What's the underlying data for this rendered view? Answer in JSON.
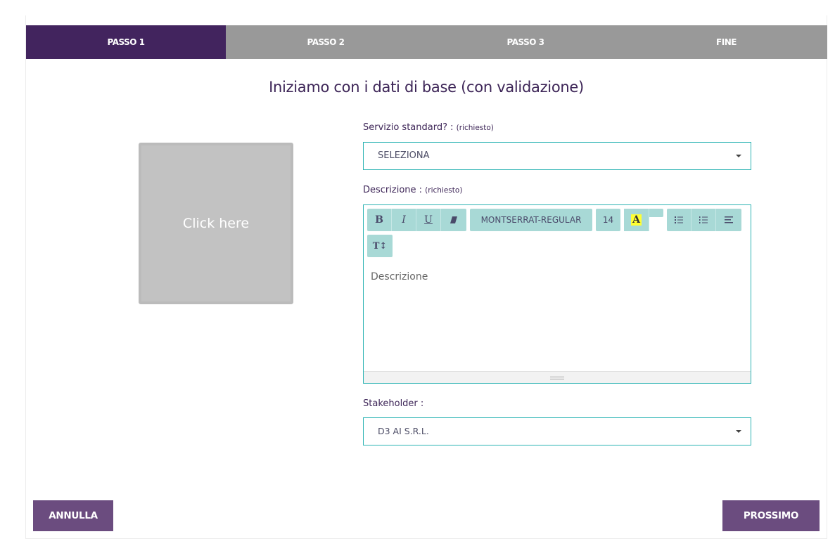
{
  "steps": [
    {
      "label": "PASSO 1",
      "active": true
    },
    {
      "label": "PASSO 2",
      "active": false
    },
    {
      "label": "PASSO 3",
      "active": false
    },
    {
      "label": "FINE",
      "active": false
    }
  ],
  "heading": "Iniziamo con i dati di base (con validazione)",
  "image_upload": {
    "label": "Click here"
  },
  "fields": {
    "servizio": {
      "label": "Servizio standard? :",
      "required": "(richiesto)",
      "value": "SELEZIONA"
    },
    "descrizione": {
      "label": "Descrizione :",
      "required": "(richiesto)",
      "placeholder": "Descrizione"
    },
    "stakeholder": {
      "label": "Stakeholder :",
      "value": "D3 AI S.R.L."
    }
  },
  "toolbar": {
    "bold": "B",
    "italic": "I",
    "underline": "U",
    "font_name": "MONTSERRAT-REGULAR",
    "font_size": "14",
    "color_glyph": "A",
    "height_glyph": "T↕"
  },
  "colors": {
    "active_step": "#42245e",
    "inactive_step": "#999999",
    "accent_border": "#2bb3b3",
    "toolbar_button": "#a8d9d6",
    "primary_button": "#6b4c7f"
  },
  "buttons": {
    "cancel": "ANNULLA",
    "next": "PROSSIMO"
  }
}
